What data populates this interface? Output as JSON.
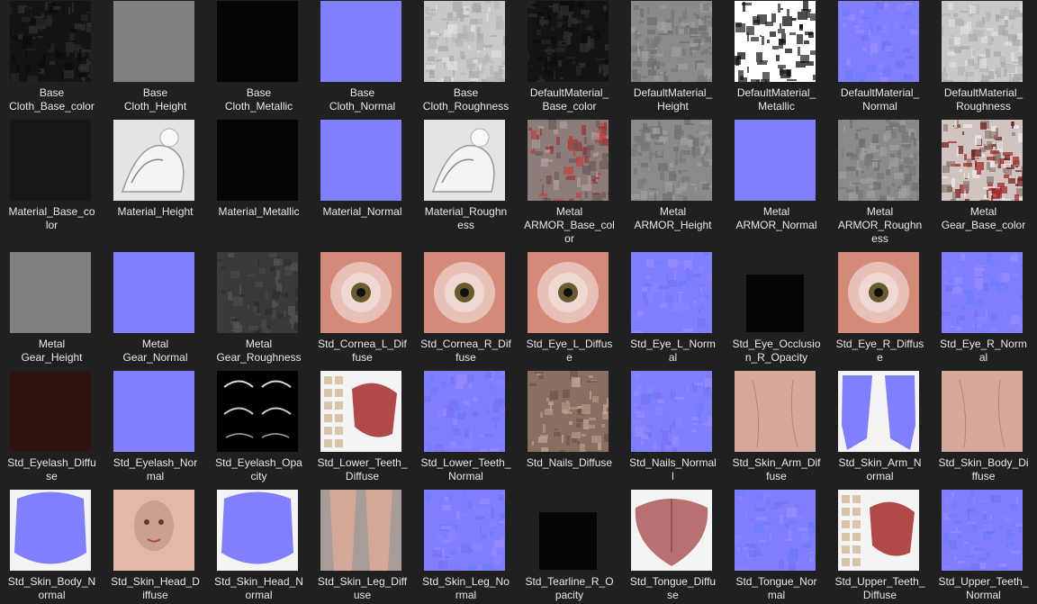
{
  "thumb_colors": {
    "base_color_dark": "#141414",
    "height_gray": "#808080",
    "metallic_black": "#050505",
    "normal_blue": "#7f7fff",
    "roughness_light": "#c8c8c8",
    "eye_pink": "#d48a78",
    "eyelash_brown": "#2e1410",
    "skin": "#d6a898"
  },
  "items": [
    {
      "label": "Base\nCloth_Base_color",
      "thumb": "noise-dark"
    },
    {
      "label": "Base\nCloth_Height",
      "thumb": "flat-gray"
    },
    {
      "label": "Base\nCloth_Metallic",
      "thumb": "flat-black"
    },
    {
      "label": "Base\nCloth_Normal",
      "thumb": "flat-normal"
    },
    {
      "label": "Base\nCloth_Roughness",
      "thumb": "noise-light"
    },
    {
      "label": "DefaultMaterial_\nBase_color",
      "thumb": "noise-dark"
    },
    {
      "label": "DefaultMaterial_\nHeight",
      "thumb": "noise-mid"
    },
    {
      "label": "DefaultMaterial_\nMetallic",
      "thumb": "blotch-bw"
    },
    {
      "label": "DefaultMaterial_\nNormal",
      "thumb": "noise-normal"
    },
    {
      "label": "DefaultMaterial_\nRoughness",
      "thumb": "noise-light"
    },
    {
      "label": "Material_Base_co\nlor",
      "thumb": "flat-darkgray"
    },
    {
      "label": "Material_Height",
      "thumb": "sculpt-white"
    },
    {
      "label": "Material_Metallic",
      "thumb": "flat-black"
    },
    {
      "label": "Material_Normal",
      "thumb": "flat-normal"
    },
    {
      "label": "Material_Roughn\ness",
      "thumb": "sculpt-white"
    },
    {
      "label": "Metal\nARMOR_Base_col\nor",
      "thumb": "armor-red"
    },
    {
      "label": "Metal\nARMOR_Height",
      "thumb": "noise-mid"
    },
    {
      "label": "Metal\nARMOR_Normal",
      "thumb": "flat-normal"
    },
    {
      "label": "Metal\nARMOR_Roughn\ness",
      "thumb": "noise-mid"
    },
    {
      "label": "Metal\nGear_Base_color",
      "thumb": "gear-color"
    },
    {
      "label": "Metal\nGear_Height",
      "thumb": "flat-gray"
    },
    {
      "label": "Metal\nGear_Normal",
      "thumb": "flat-normal"
    },
    {
      "label": "Metal\nGear_Roughness",
      "thumb": "noise-dark2"
    },
    {
      "label": "Std_Cornea_L_Dif\nfuse",
      "thumb": "eye"
    },
    {
      "label": "Std_Cornea_R_Dif\nfuse",
      "thumb": "eye"
    },
    {
      "label": "Std_Eye_L_Diffus\ne",
      "thumb": "eye"
    },
    {
      "label": "Std_Eye_L_Norm\nal",
      "thumb": "noise-normal"
    },
    {
      "label": "Std_Eye_Occlusio\nn_R_Opacity",
      "thumb": "small-black"
    },
    {
      "label": "Std_Eye_R_Diffus\ne",
      "thumb": "eye"
    },
    {
      "label": "Std_Eye_R_Norm\nal",
      "thumb": "noise-normal"
    },
    {
      "label": "Std_Eyelash_Diffu\nse",
      "thumb": "flat-brown"
    },
    {
      "label": "Std_Eyelash_Nor\nmal",
      "thumb": "flat-normal"
    },
    {
      "label": "Std_Eyelash_Opa\ncity",
      "thumb": "eyelash"
    },
    {
      "label": "Std_Lower_Teeth_\nDiffuse",
      "thumb": "teeth"
    },
    {
      "label": "Std_Lower_Teeth_\nNormal",
      "thumb": "noise-normal"
    },
    {
      "label": "Std_Nails_Diffuse",
      "thumb": "nails"
    },
    {
      "label": "Std_Nails_Normal\nl",
      "thumb": "noise-normal"
    },
    {
      "label": "Std_Skin_Arm_Dif\nfuse",
      "thumb": "skin"
    },
    {
      "label": "Std_Skin_Arm_N\normal",
      "thumb": "normal-arm"
    },
    {
      "label": "Std_Skin_Body_Di\nffuse",
      "thumb": "skin"
    },
    {
      "label": "Std_Skin_Body_N\normal",
      "thumb": "normal-body"
    },
    {
      "label": "Std_Skin_Head_D\niffuse",
      "thumb": "skin-head"
    },
    {
      "label": "Std_Skin_Head_N\normal",
      "thumb": "normal-body"
    },
    {
      "label": "Std_Skin_Leg_Diff\nuse",
      "thumb": "skin-leg"
    },
    {
      "label": "Std_Skin_Leg_No\nrmal",
      "thumb": "noise-normal"
    },
    {
      "label": "Std_Tearline_R_O\npacity",
      "thumb": "small-black"
    },
    {
      "label": "Std_Tongue_Diffu\nse",
      "thumb": "tongue"
    },
    {
      "label": "Std_Tongue_Nor\nmal",
      "thumb": "noise-normal"
    },
    {
      "label": "Std_Upper_Teeth_\nDiffuse",
      "thumb": "teeth"
    },
    {
      "label": "Std_Upper_Teeth_\nNormal",
      "thumb": "noise-normal"
    }
  ]
}
